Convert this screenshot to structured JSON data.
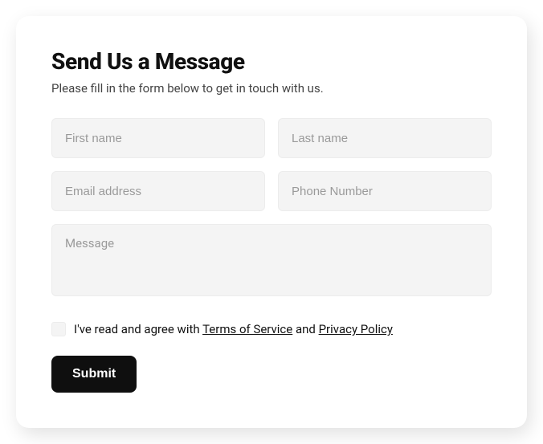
{
  "form": {
    "title": "Send Us a Message",
    "subtitle": "Please fill in the form below to get in touch with us.",
    "fields": {
      "first_name": {
        "placeholder": "First name",
        "value": ""
      },
      "last_name": {
        "placeholder": "Last name",
        "value": ""
      },
      "email": {
        "placeholder": "Email address",
        "value": ""
      },
      "phone": {
        "placeholder": "Phone Number",
        "value": ""
      },
      "message": {
        "placeholder": "Message",
        "value": ""
      }
    },
    "consent": {
      "prefix": "I've read and agree with ",
      "tos_label": "Terms of Service",
      "middle": " and ",
      "privacy_label": "Privacy Policy",
      "checked": false
    },
    "submit_label": "Submit"
  }
}
